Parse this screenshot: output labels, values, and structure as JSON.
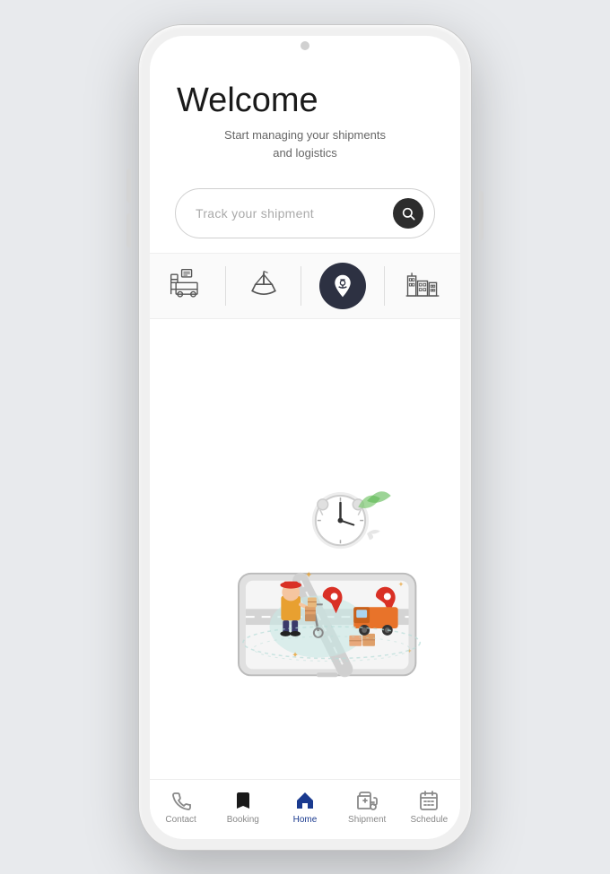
{
  "phone": {
    "header": {
      "welcome_title": "Welcome",
      "welcome_subtitle_line1": "Start managing your shipments",
      "welcome_subtitle_line2": "and logistics"
    },
    "search": {
      "placeholder": "Track  your shipment"
    },
    "categories": [
      {
        "id": "truck",
        "label": "Truck"
      },
      {
        "id": "ship",
        "label": "Ship"
      },
      {
        "id": "location",
        "label": "Location",
        "highlighted": true
      },
      {
        "id": "city",
        "label": "City"
      }
    ],
    "bottom_nav": [
      {
        "id": "contact",
        "label": "Contact",
        "active": false
      },
      {
        "id": "booking",
        "label": "Booking",
        "active": false
      },
      {
        "id": "home",
        "label": "Home",
        "active": true
      },
      {
        "id": "shipment",
        "label": "Shipment",
        "active": false
      },
      {
        "id": "schedule",
        "label": "Schedule",
        "active": false
      }
    ],
    "colors": {
      "accent_blue": "#1a3a8f",
      "accent_dark": "#2d2d2d",
      "orange": "#e8732a",
      "red_pin": "#d93025",
      "light_teal": "#b8ddd8"
    }
  }
}
